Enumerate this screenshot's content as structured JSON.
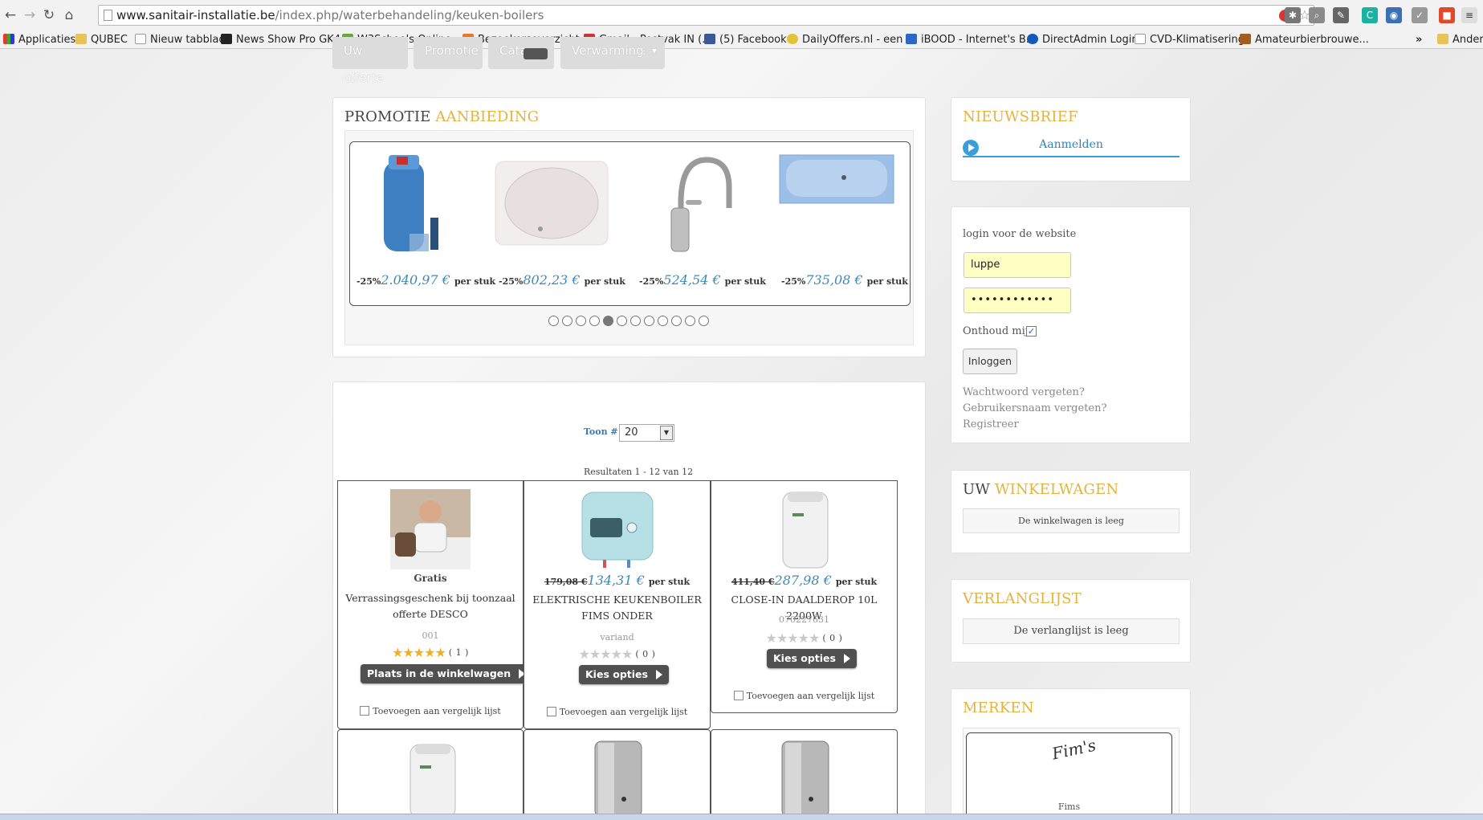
{
  "browser": {
    "url_domain": "www.sanitair-installatie.be",
    "url_path": "/index.php/waterbehandeling/keuken-boilers",
    "more_label": "»",
    "bookmarks": [
      "Applicaties",
      "QUBEC",
      "Nieuw tabblad",
      "News Show Pro GK4...",
      "W3Schools Online ...",
      "Bezoekersoverzicht -...",
      "Gmail - Postvak IN (...",
      "(5) Facebook",
      "DailyOffers.nl - een ...",
      "iBOOD - Internet's B...",
      "DirectAdmin Login",
      "CVD-Klimatisering",
      "Amateurbierbrouwe...",
      "Andere"
    ]
  },
  "menu": {
    "tabs": [
      "Uw offerte",
      "Promotie",
      "Cata",
      "Verwarming"
    ]
  },
  "promo": {
    "title_a": "PROMOTIE",
    "title_b": "AANBIEDING",
    "items": [
      {
        "discount": "-25%",
        "price": "2.040,97 €",
        "unit": "per stuk"
      },
      {
        "discount": "-25%",
        "price": "802,23 €",
        "unit": "per stuk"
      },
      {
        "discount": "-25%",
        "price": "524,54 €",
        "unit": "per stuk"
      },
      {
        "discount": "-25%",
        "price": "735,08 €",
        "unit": "per stuk"
      }
    ],
    "dot_count": 12,
    "active_dot": 5
  },
  "listing": {
    "show_label": "Toon #",
    "show_value": "20",
    "results": "Resultaten 1 - 12 van 12",
    "products": [
      {
        "price": "Gratis",
        "old_price": "",
        "unit": "",
        "name": "Verrassingsgeschenk bij toonzaal offerte DESCO",
        "sku": "001",
        "rating": 5,
        "count": "( 1 )",
        "button": "Plaats in de winkelwagen",
        "compare": "Toevoegen aan vergelijk lijst"
      },
      {
        "price": "134,31 €",
        "old_price": "179,08 €",
        "unit": "per stuk",
        "name": "ELEKTRISCHE KEUKENBOILER FIMS ONDER",
        "sku": "variand",
        "rating": 0,
        "count": "( 0 )",
        "button": "Kies opties",
        "compare": "Toevoegen aan vergelijk lijst"
      },
      {
        "price": "287,98 €",
        "old_price": "411,40 €",
        "unit": "per stuk",
        "name": "CLOSE-IN DAALDEROP 10L 2200W",
        "sku": "070227631",
        "rating": 0,
        "count": "( 0 )",
        "button": "Kies opties",
        "compare": "Toevoegen aan vergelijk lijst"
      }
    ]
  },
  "newsletter": {
    "title": "NIEUWSBRIEF",
    "link": "Aanmelden"
  },
  "login": {
    "heading": "login voor de website",
    "username": "luppe",
    "password": "••••••••••••",
    "remember": "Onthoud mij",
    "button": "Inloggen",
    "forgot_password": "Wachtwoord vergeten?",
    "forgot_username": "Gebruikersnaam vergeten?",
    "register": "Registreer"
  },
  "cart": {
    "title_a": "UW",
    "title_b": "WINKELWAGEN",
    "empty": "De winkelwagen is leeg"
  },
  "wishlist": {
    "title": "VERLANGLIJST",
    "empty": "De verlanglijst is leeg"
  },
  "brands": {
    "title": "MERKEN",
    "logo_text": "Fim's",
    "brand_name": "Fims"
  }
}
